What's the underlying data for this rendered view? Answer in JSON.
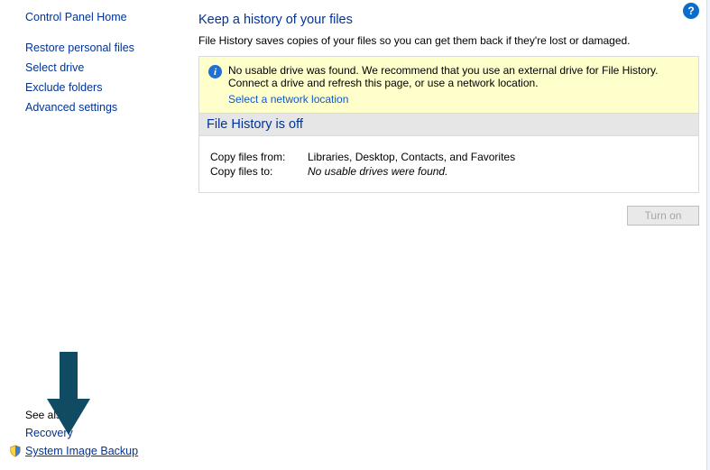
{
  "sidebar": {
    "home": "Control Panel Home",
    "links": {
      "restore": "Restore personal files",
      "select_drive": "Select drive",
      "exclude": "Exclude folders",
      "advanced": "Advanced settings"
    },
    "see_also": "See also",
    "recovery": "Recovery",
    "system_image_backup": "System Image Backup"
  },
  "main": {
    "help": "?",
    "heading": "Keep a history of your files",
    "sub": "File History saves copies of your files so you can get them back if they're lost or damaged.",
    "warn_line1": "No usable drive was found. We recommend that you use an external drive for File History. Connect a drive and refresh this page, or use a network location.",
    "warn_link": "Select a network location",
    "status": "File History is off",
    "copy_from_label": "Copy files from:",
    "copy_from_value": "Libraries, Desktop, Contacts, and Favorites",
    "copy_to_label": "Copy files to:",
    "copy_to_value": "No usable drives were found.",
    "turn_on": "Turn on"
  }
}
